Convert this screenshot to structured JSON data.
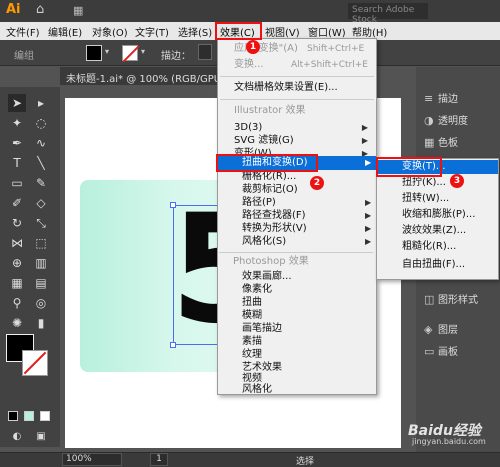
{
  "titlebar": {
    "logo": "Ai",
    "search_placeholder": "Search Adobe Stock"
  },
  "menubar": [
    "文件(F)",
    "编辑(E)",
    "对象(O)",
    "文字(T)",
    "选择(S)",
    "效果(C)",
    "视图(V)",
    "窗口(W)",
    "帮助(H)"
  ],
  "controlbar": {
    "label": "编组",
    "stroke_label": "描边："
  },
  "document_tab": {
    "title": "未标题-1.ai* @ 100% (RGB/GPU"
  },
  "canvas": {
    "glyph": "5"
  },
  "effect_menu": {
    "apply_last": "应用\"变换\"(A)",
    "apply_last_shortcut": "Shift+Ctrl+E",
    "last_effect": "变换...",
    "last_effect_shortcut": "Alt+Shift+Ctrl+E",
    "raster_settings": "文档栅格效果设置(E)...",
    "illustrator_header": "Illustrator 效果",
    "illustrator_items": [
      "3D(3)",
      "SVG 滤镜(G)",
      "变形(W)",
      "扭曲和变换(D)",
      "栅格化(R)...",
      "裁剪标记(O)",
      "路径(P)",
      "路径查找器(F)",
      "转换为形状(V)",
      "风格化(S)"
    ],
    "photoshop_header": "Photoshop 效果",
    "photoshop_items": [
      "效果画廊...",
      "像素化",
      "扭曲",
      "模糊",
      "画笔描边",
      "素描",
      "纹理",
      "艺术效果",
      "视频",
      "风格化"
    ]
  },
  "distort_submenu": {
    "items": [
      "变换(T)...",
      "扭拧(K)...",
      "扭转(W)...",
      "收缩和膨胀(P)...",
      "波纹效果(Z)...",
      "粗糙化(R)...",
      "自由扭曲(F)..."
    ]
  },
  "right_panel": {
    "items": [
      "描边",
      "透明度",
      "色板",
      "图形样式",
      "图层",
      "画板"
    ]
  },
  "statusbar": {
    "zoom": "100%",
    "page": "1",
    "status": "选择"
  },
  "annotations": {
    "badge1": "1",
    "badge2": "2",
    "badge3": "3"
  },
  "watermark": {
    "text": "Baidu经验",
    "sub": "jingyan.baidu.com"
  },
  "colors": {
    "highlight": "#0b6fd8",
    "annotation_red": "#e11111",
    "gradient_start": "#b8f0dc"
  }
}
